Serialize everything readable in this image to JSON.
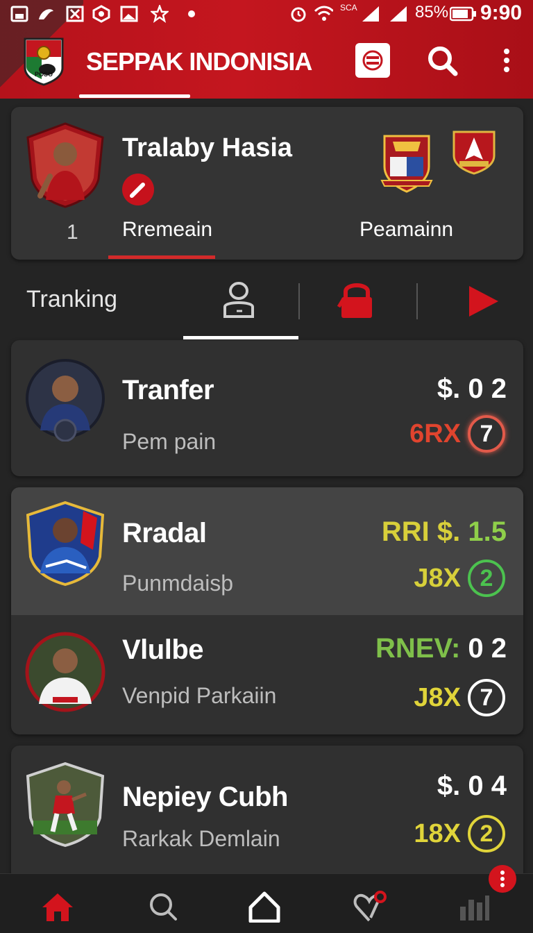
{
  "status_bar": {
    "network_label": "SCA",
    "battery": "85%",
    "time": "9:90"
  },
  "app": {
    "title": "SEPPAK INDONISIA",
    "logo_text": "POSO"
  },
  "profile": {
    "name": "Tralaby Hasia",
    "number": "1",
    "tab_active": "Rremeain",
    "tab_other": "Peamainn"
  },
  "filter": {
    "label": "Tranking"
  },
  "players": [
    {
      "name": "Tranfer",
      "subtitle": "Pem pain",
      "price": "$. 0 2",
      "price_prefix": "",
      "multiplier": "6RX",
      "rank": "7",
      "mult_color": "#e0442e",
      "circle_color": "#e25a4a"
    },
    {
      "name": "Rradal",
      "subtitle": "Punmdaisþ",
      "price": "1.5",
      "price_prefix": "RRI $.",
      "multiplier": "J8X",
      "rank": "2",
      "mult_color": "#d7d03a",
      "circle_color": "#4cc24f"
    },
    {
      "name": "Vlulbe",
      "subtitle": "Venpid Parkaiin",
      "price": "0 2",
      "price_prefix": "RNEV:",
      "multiplier": "J8X",
      "rank": "7",
      "mult_color": "#e0d43a",
      "circle_color": "#ffffff"
    },
    {
      "name": "Nepiey Cubh",
      "subtitle": "Rarkak Demlain",
      "price": "$. 0 4",
      "price_prefix": "",
      "multiplier": "18X",
      "rank": "2",
      "mult_color": "#e0d43a",
      "circle_color": "#e0d43a"
    }
  ],
  "colors": {
    "brand_red": "#c4161f",
    "background": "#242424",
    "card": "#303030"
  },
  "icons": {
    "nav": [
      "home-icon",
      "search-icon",
      "house-outline-icon",
      "heart-pin-icon",
      "stats-icon"
    ]
  }
}
